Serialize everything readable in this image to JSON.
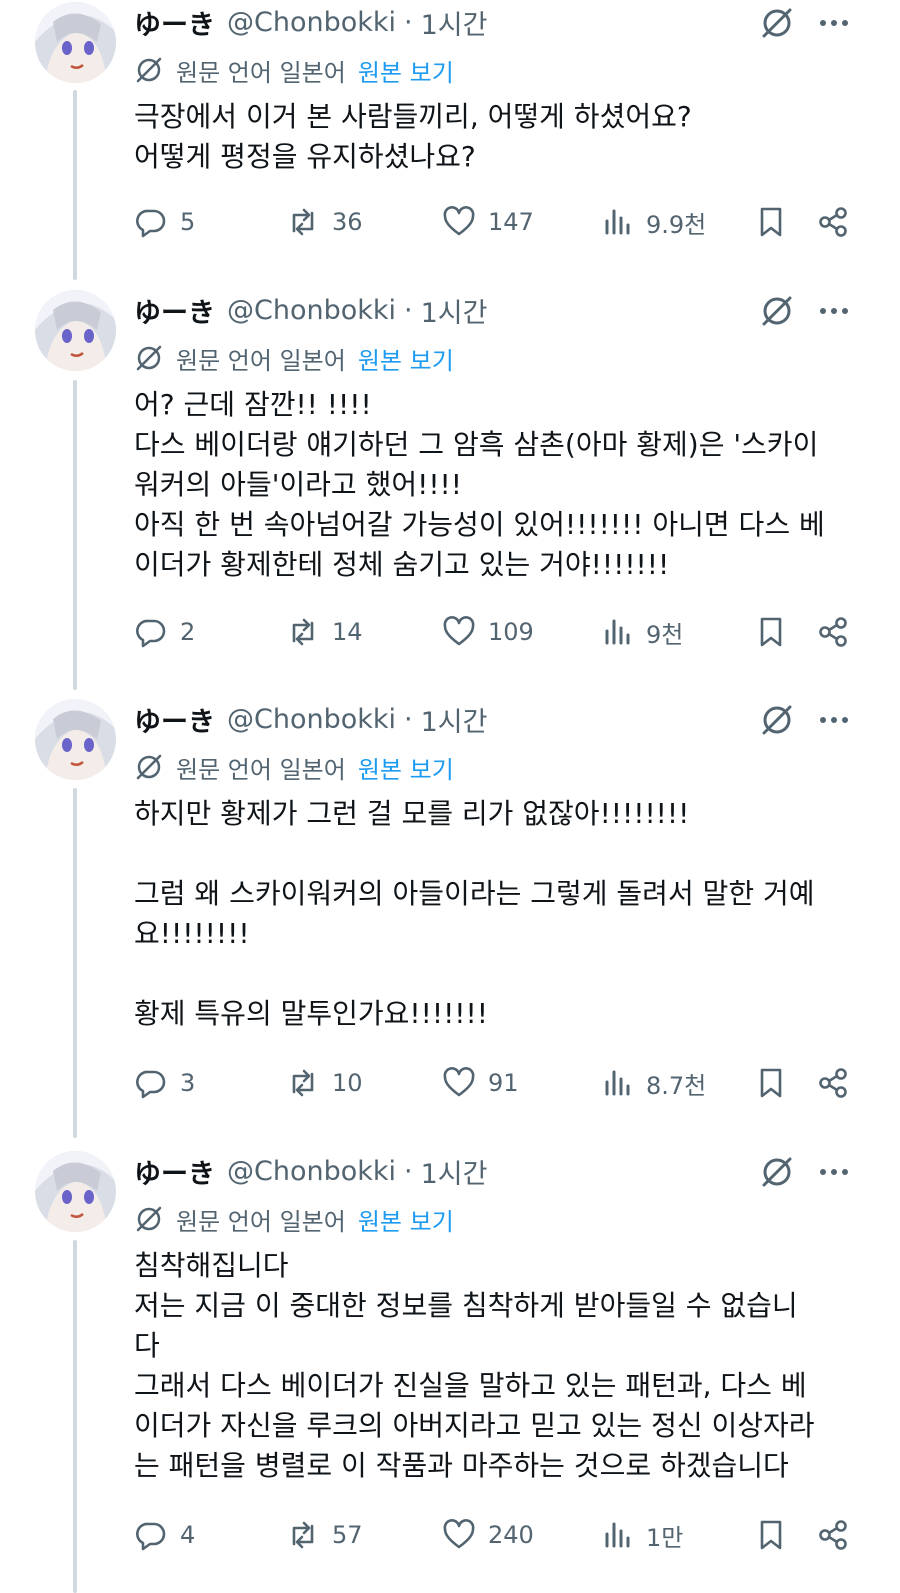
{
  "posts": [
    {
      "name": "ゆーき",
      "handle": "@Chonbokki",
      "separator": "·",
      "time": "1시간",
      "translated_label": "원문 언어 일본어",
      "view_original": "원본 보기",
      "lines": [
        "극장에서 이거 본 사람들끼리, 어떻게 하셨어요?",
        "어떻게 평정을 유지하셨나요?"
      ],
      "replies": "5",
      "reposts": "36",
      "likes": "147",
      "views": "9.9천"
    },
    {
      "name": "ゆーき",
      "handle": "@Chonbokki",
      "separator": "·",
      "time": "1시간",
      "translated_label": "원문 언어 일본어",
      "view_original": "원본 보기",
      "lines": [
        "어? 근데 잠깐!! !!!!",
        "다스 베이더랑 얘기하던 그 암흑 삼촌(아마 황제)은 '스카이",
        "워커의 아들'이라고 했어!!!!",
        "아직 한 번 속아넘어갈 가능성이 있어!!!!!!! 아니면 다스 베",
        "이더가 황제한테 정체 숨기고 있는 거야!!!!!!!"
      ],
      "replies": "2",
      "reposts": "14",
      "likes": "109",
      "views": "9천"
    },
    {
      "name": "ゆーき",
      "handle": "@Chonbokki",
      "separator": "·",
      "time": "1시간",
      "translated_label": "원문 언어 일본어",
      "view_original": "원본 보기",
      "lines": [
        "하지만 황제가 그런 걸 모를 리가 없잖아!!!!!!!!",
        "",
        "그럼 왜 스카이워커의 아들이라는 그렇게 돌려서 말한 거예",
        "요!!!!!!!!",
        "",
        "황제 특유의 말투인가요!!!!!!!"
      ],
      "replies": "3",
      "reposts": "10",
      "likes": "91",
      "views": "8.7천"
    },
    {
      "name": "ゆーき",
      "handle": "@Chonbokki",
      "separator": "·",
      "time": "1시간",
      "translated_label": "원문 언어 일본어",
      "view_original": "원본 보기",
      "lines": [
        "침착해집니다",
        "저는 지금 이 중대한 정보를 침착하게 받아들일 수 없습니",
        "다",
        "그래서 다스 베이더가 진실을 말하고 있는 패턴과, 다스 베",
        "이더가 자신을 루크의 아버지라고 믿고 있는 정신 이상자라",
        "는 패턴을 병렬로 이 작품과 마주하는 것으로 하겠습니다"
      ],
      "replies": "4",
      "reposts": "57",
      "likes": "240",
      "views": "1만"
    }
  ],
  "colors": {
    "text": "#0f1419",
    "secondary": "#536471",
    "link": "#1d9bf0",
    "thread_line": "#cfd9de"
  },
  "icons": [
    "grok-icon",
    "more-icon",
    "translate-icon",
    "reply-icon",
    "repost-icon",
    "like-icon",
    "views-icon",
    "bookmark-icon",
    "share-icon"
  ]
}
